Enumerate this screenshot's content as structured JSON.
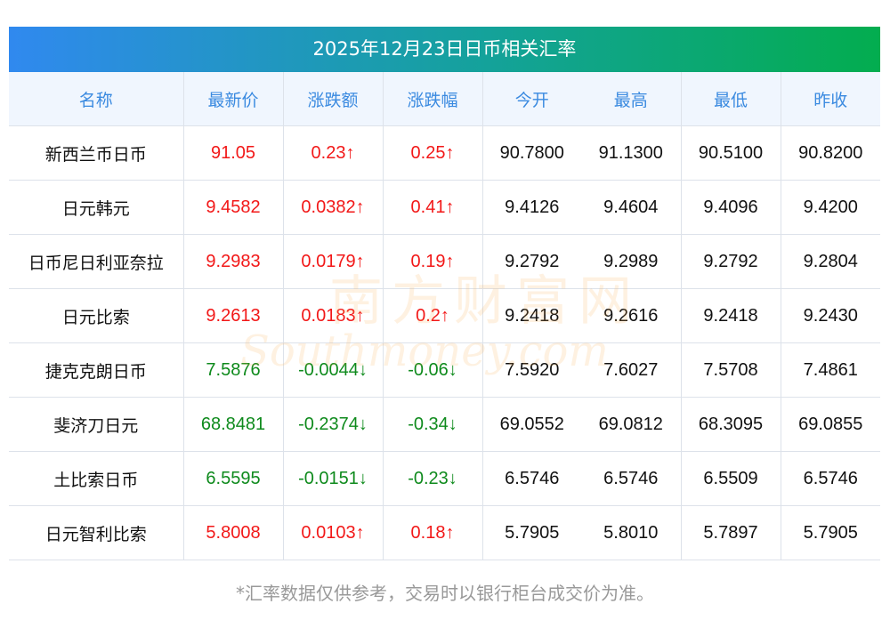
{
  "title": "2025年12月23日日币相关汇率",
  "headers": [
    "名称",
    "最新价",
    "涨跌额",
    "涨跌幅",
    "今开",
    "最高",
    "最低",
    "昨收"
  ],
  "rows": [
    {
      "name": "新西兰币日币",
      "latest": "91.05",
      "change": "0.23↑",
      "pct": "0.25↑",
      "open": "90.7800",
      "high": "91.1300",
      "low": "90.5100",
      "prev": "90.8200",
      "dir": "up"
    },
    {
      "name": "日元韩元",
      "latest": "9.4582",
      "change": "0.0382↑",
      "pct": "0.41↑",
      "open": "9.4126",
      "high": "9.4604",
      "low": "9.4096",
      "prev": "9.4200",
      "dir": "up"
    },
    {
      "name": "日币尼日利亚奈拉",
      "latest": "9.2983",
      "change": "0.0179↑",
      "pct": "0.19↑",
      "open": "9.2792",
      "high": "9.2989",
      "low": "9.2792",
      "prev": "9.2804",
      "dir": "up"
    },
    {
      "name": "日元比索",
      "latest": "9.2613",
      "change": "0.0183↑",
      "pct": "0.2↑",
      "open": "9.2418",
      "high": "9.2616",
      "low": "9.2418",
      "prev": "9.2430",
      "dir": "up"
    },
    {
      "name": "捷克克朗日币",
      "latest": "7.5876",
      "change": "-0.0044↓",
      "pct": "-0.06↓",
      "open": "7.5920",
      "high": "7.6027",
      "low": "7.5708",
      "prev": "7.4861",
      "dir": "down"
    },
    {
      "name": "斐济刀日元",
      "latest": "68.8481",
      "change": "-0.2374↓",
      "pct": "-0.34↓",
      "open": "69.0552",
      "high": "69.0812",
      "low": "68.3095",
      "prev": "69.0855",
      "dir": "down"
    },
    {
      "name": "土比索日币",
      "latest": "6.5595",
      "change": "-0.0151↓",
      "pct": "-0.23↓",
      "open": "6.5746",
      "high": "6.5746",
      "low": "6.5509",
      "prev": "6.5746",
      "dir": "down"
    },
    {
      "name": "日元智利比索",
      "latest": "5.8008",
      "change": "0.0103↑",
      "pct": "0.18↑",
      "open": "5.7905",
      "high": "5.8010",
      "low": "5.7897",
      "prev": "5.7905",
      "dir": "up"
    }
  ],
  "footer": "*汇率数据仅供参考，交易时以银行柜台成交价为准。",
  "watermark": {
    "cn": "南方财富网",
    "en": "Southmoney.com"
  },
  "colors": {
    "up": "#f21818",
    "down": "#0e8a1c",
    "header_text": "#3a8ae0"
  }
}
